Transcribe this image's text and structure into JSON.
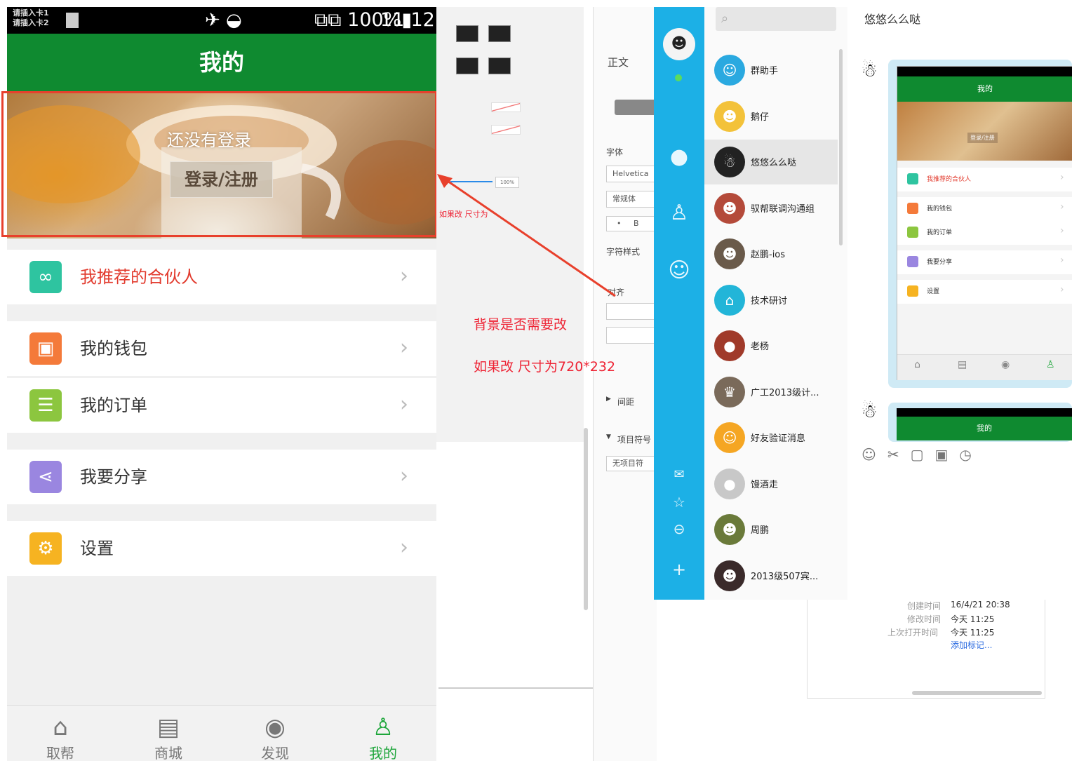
{
  "phone": {
    "status": {
      "carrier1": "请插入卡1",
      "carrier2": "请插入卡2",
      "signal_icons": "✈ ◒",
      "battery": "⧉⧉ 100%▮",
      "time": "11:12"
    },
    "header_title": "我的",
    "banner": {
      "not_logged_in": "还没有登录",
      "login_button": "登录/注册"
    },
    "menu": [
      {
        "label": "我推荐的合伙人",
        "icon": "partners-icon",
        "glyph": "∞",
        "color": "#2ec4a0",
        "label_color": "#e23b2e"
      },
      {
        "label": "我的钱包",
        "icon": "wallet-icon",
        "glyph": "▣",
        "color": "#f47a3a",
        "label_color": "#333333"
      },
      {
        "label": "我的订单",
        "icon": "order-icon",
        "glyph": "☰",
        "color": "#8cc63f",
        "label_color": "#333333"
      },
      {
        "label": "我要分享",
        "icon": "share-icon",
        "glyph": "⋖",
        "color": "#9a86e0",
        "label_color": "#333333"
      },
      {
        "label": "设置",
        "icon": "settings-icon",
        "glyph": "⚙",
        "color": "#f6b321",
        "label_color": "#333333"
      }
    ],
    "tabs": [
      {
        "label": "取帮",
        "icon": "home-icon",
        "glyph": "⌂"
      },
      {
        "label": "商城",
        "icon": "store-icon",
        "glyph": "▤"
      },
      {
        "label": "发现",
        "icon": "eye-icon",
        "glyph": "◉"
      },
      {
        "label": "我的",
        "icon": "person-icon",
        "glyph": "♙"
      }
    ],
    "active_tab_color": "#1ea63b",
    "header_color": "#0f8a30"
  },
  "annotations": {
    "question": "背景是否需要改",
    "size_note": "如果改 尺寸为720*232",
    "small_note": "如果改 尺寸为"
  },
  "editor": {
    "style_label": "正文",
    "font_label": "字体",
    "font_value": "Helvetica",
    "typeface_value": "常规体",
    "char_style_label": "字符样式",
    "align_label": "对齐",
    "spacing_label": "间距",
    "list_label": "项目符号",
    "list_value": "无项目符",
    "percent": "100%"
  },
  "qq": {
    "chat_title": "悠悠么么哒",
    "contacts": [
      {
        "name": "群助手",
        "color": "#2aa9e0",
        "glyph": "☺"
      },
      {
        "name": "鹅仔",
        "color": "#f3c23a",
        "glyph": "☻"
      },
      {
        "name": "悠悠么么哒",
        "color": "#222222",
        "glyph": "☃"
      },
      {
        "name": "驭帮联调沟通组",
        "color": "#b44a3a",
        "glyph": "☻"
      },
      {
        "name": "赵鹏-ios",
        "color": "#6a5a4a",
        "glyph": "☻"
      },
      {
        "name": "技术研讨",
        "color": "#22b5d8",
        "glyph": "⌂"
      },
      {
        "name": "老杨",
        "color": "#a03a2a",
        "glyph": "●"
      },
      {
        "name": "广工2013级计...",
        "color": "#7a6a5a",
        "glyph": "♛"
      },
      {
        "name": "好友验证消息",
        "color": "#f5a623",
        "glyph": "☺"
      },
      {
        "name": "馒酒走",
        "color": "#c8c8c8",
        "glyph": "●"
      },
      {
        "name": "周鹏",
        "color": "#6a7a3a",
        "glyph": "☻"
      },
      {
        "name": "2013级507宾...",
        "color": "#3a2a2a",
        "glyph": "☻"
      }
    ],
    "thumb": {
      "title": "我的",
      "login": "登录/注册",
      "items": [
        {
          "label": "我推荐的合伙人",
          "color": "#2ec4a0"
        },
        {
          "label": "我的钱包",
          "color": "#f47a3a"
        },
        {
          "label": "我的订单",
          "color": "#8cc63f"
        },
        {
          "label": "我要分享",
          "color": "#9a86e0"
        },
        {
          "label": "设置",
          "color": "#f6b321"
        }
      ]
    },
    "toolbar_icons": [
      "emoji-icon",
      "scissors-icon",
      "window-icon",
      "image-icon",
      "clock-icon"
    ],
    "toolbar_glyphs": "☺✂▢▣◷",
    "sidebar_color": "#1cb0e6"
  },
  "file_info": {
    "created_label": "创建时间",
    "created_value": "16/4/21 20:38",
    "modified_label": "修改时间",
    "modified_value": "今天 11:25",
    "opened_label": "上次打开时间",
    "opened_value": "今天 11:25",
    "add_tag": "添加标记..."
  }
}
